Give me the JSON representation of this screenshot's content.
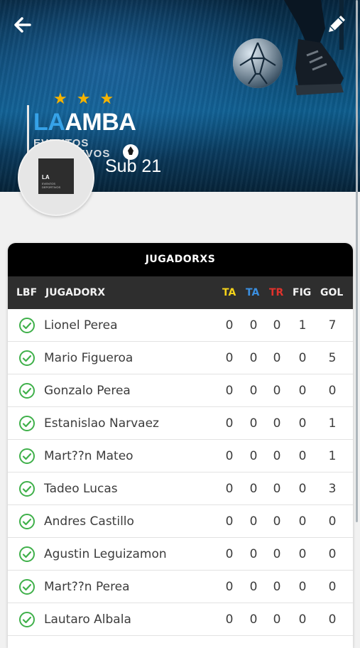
{
  "header": {
    "back_icon": "arrow-left-icon",
    "edit_icon": "pencil-icon",
    "logo": {
      "stars": "★★★",
      "name_part1": "LA",
      "name_part2": "AMBA",
      "subtitle": "EVENTOS DEPORTIVOS"
    },
    "team_name": "Sub 21"
  },
  "table": {
    "title": "JUGADORXS",
    "columns": [
      {
        "label": "LBF",
        "color": "#f2f2f2"
      },
      {
        "label": "JUGADORX",
        "color": "#f2f2f2"
      },
      {
        "label": "TA",
        "color": "#f4d21a"
      },
      {
        "label": "TA",
        "color": "#3b8fe0"
      },
      {
        "label": "TR",
        "color": "#e0322c"
      },
      {
        "label": "FIG",
        "color": "#f2f2f2"
      },
      {
        "label": "GOL",
        "color": "#f2f2f2"
      }
    ],
    "rows": [
      {
        "name": "Lionel Perea",
        "ta_yellow": "0",
        "ta_blue": "0",
        "tr": "0",
        "fig": "1",
        "gol": "7"
      },
      {
        "name": "Mario Figueroa",
        "ta_yellow": "0",
        "ta_blue": "0",
        "tr": "0",
        "fig": "0",
        "gol": "5"
      },
      {
        "name": "Gonzalo Perea",
        "ta_yellow": "0",
        "ta_blue": "0",
        "tr": "0",
        "fig": "0",
        "gol": "0"
      },
      {
        "name": "Estanislao Narvaez",
        "ta_yellow": "0",
        "ta_blue": "0",
        "tr": "0",
        "fig": "0",
        "gol": "1"
      },
      {
        "name": "Mart??n Mateo",
        "ta_yellow": "0",
        "ta_blue": "0",
        "tr": "0",
        "fig": "0",
        "gol": "1"
      },
      {
        "name": "Tadeo Lucas",
        "ta_yellow": "0",
        "ta_blue": "0",
        "tr": "0",
        "fig": "0",
        "gol": "3"
      },
      {
        "name": "Andres Castillo",
        "ta_yellow": "0",
        "ta_blue": "0",
        "tr": "0",
        "fig": "0",
        "gol": "0"
      },
      {
        "name": "Agustin Leguizamon",
        "ta_yellow": "0",
        "ta_blue": "0",
        "tr": "0",
        "fig": "0",
        "gol": "0"
      },
      {
        "name": "Mart??n Perea",
        "ta_yellow": "0",
        "ta_blue": "0",
        "tr": "0",
        "fig": "0",
        "gol": "0"
      },
      {
        "name": "Lautaro Albala",
        "ta_yellow": "0",
        "ta_blue": "0",
        "tr": "0",
        "fig": "0",
        "gol": "0"
      }
    ]
  },
  "colors": {
    "header_bg": "#0b4a73",
    "check_green": "#3fb04a",
    "card_title_bg": "#000000",
    "thead_bg": "#2e2e2e"
  }
}
